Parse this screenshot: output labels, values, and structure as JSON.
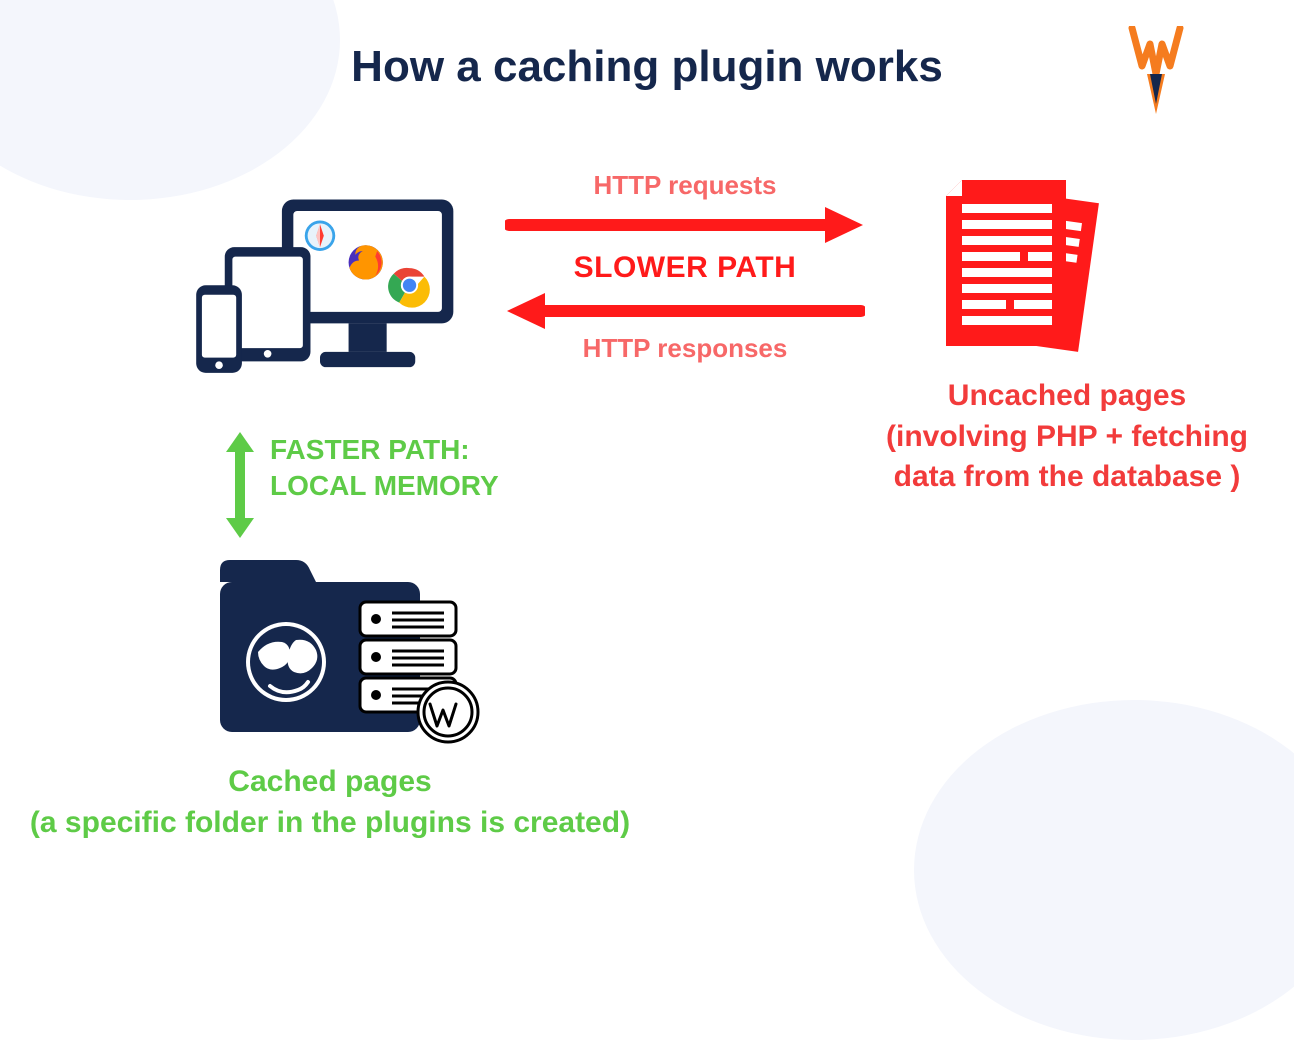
{
  "title": "How a caching plugin works",
  "slower": {
    "requests": "HTTP requests",
    "path": "SLOWER PATH",
    "responses": "HTTP responses"
  },
  "uncached": {
    "line1": "Uncached pages",
    "line2": "(involving PHP + fetching",
    "line3": "data from the database )"
  },
  "faster": {
    "line1": "FASTER PATH:",
    "line2": "LOCAL MEMORY"
  },
  "cached": {
    "line1": "Cached pages",
    "line2": "(a specific folder in the plugins is created)"
  },
  "colors": {
    "navy": "#15274c",
    "red": "#ff1a1a",
    "salmon": "#f76868",
    "green": "#5ecb47",
    "orange": "#f57c1f"
  }
}
